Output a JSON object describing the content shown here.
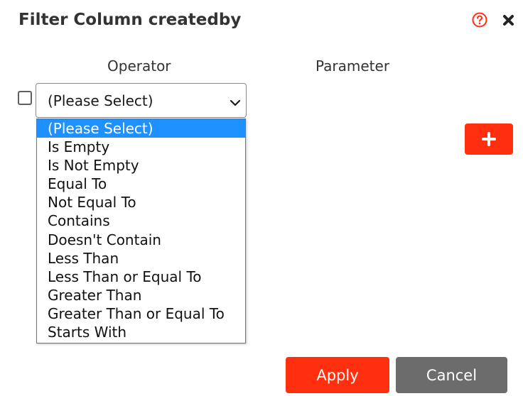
{
  "dialog": {
    "title": "Filter Column createdby",
    "help_icon": "help-circle-icon",
    "close_icon": "close-icon"
  },
  "columns": {
    "operator": "Operator",
    "parameter": "Parameter"
  },
  "row": {
    "checked": false,
    "operator_value": "(Please Select)"
  },
  "operator_options": [
    "(Please Select)",
    "Is Empty",
    "Is Not Empty",
    "Equal To",
    "Not Equal To",
    "Contains",
    "Doesn't Contain",
    "Less Than",
    "Less Than or Equal To",
    "Greater Than",
    "Greater Than or Equal To",
    "Starts With"
  ],
  "selected_option_index": 0,
  "add_button": {
    "icon": "plus-icon"
  },
  "footer": {
    "apply_label": "Apply",
    "cancel_label": "Cancel"
  },
  "colors": {
    "accent": "#ff2f0f",
    "selection": "#1e90ff",
    "secondary_button": "#6c6c6c",
    "title_text": "#333333"
  }
}
